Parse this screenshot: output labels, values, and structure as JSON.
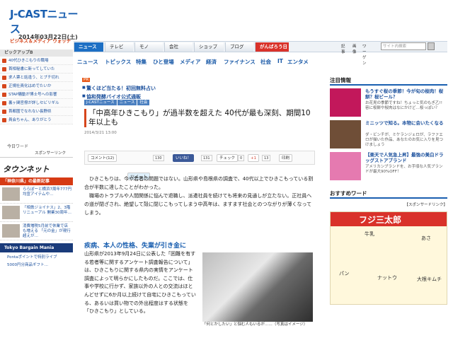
{
  "header": {
    "logo_main": "J-CASTニュース",
    "logo_sub": "ビジネス＆メディア ウォッチ",
    "date": "2014年03月22日(土)"
  },
  "nav": {
    "tabs": [
      {
        "label": "ニュース"
      },
      {
        "label": "テレビ"
      },
      {
        "label": "モノ"
      },
      {
        "label": "会社"
      },
      {
        "label": "ショップ"
      },
      {
        "label": "ブログ"
      },
      {
        "label": "がんばろう日本"
      }
    ],
    "search_tabs": [
      "記事",
      "画像",
      "ワーゲン"
    ],
    "search_placeholder": "サイト内検索"
  },
  "subnav": [
    "ニュース",
    "トピックス",
    "特集",
    "ひと登場",
    "メディア",
    "経済",
    "ファイナンス",
    "社会",
    "IT",
    "エンタメ"
  ],
  "left": {
    "pickup_title": "ピックアップB",
    "pickup_items": [
      "40代ひきこもりの職場",
      "首相秘書に新ってしていた",
      "求人票と話違う、とブチ切れ",
      "正規社員化はめでたいか",
      "STAP騒動が博士号への影響",
      "裏ヶ関官僚が詳しセビリギル",
      "首都圏でなれない長野県",
      "員会ちゃん、ありがとう"
    ],
    "tw_label": "今日ワード",
    "tw_sponsor": "スポンサーリンク",
    "townnet": "タウンネット",
    "kanagawa": "「神奈川県」の最新記事",
    "local_news": [
      "ららぽーと横浜7周年777円均宣アイテムや…",
      "「相鉄ジョイナス」2、3階リニューアル 開業30周年…",
      "消費増税5月前で休業で店も増える 「元の金」が現行超えが…"
    ],
    "tbm": "Tokyo Bargain Mania",
    "tbm_items": [
      "Pontaポイントで特別ライブ",
      "5000円分商品ギフト…"
    ]
  },
  "main": {
    "pr_badge": "PR",
    "pr_lines": [
      "驚くほど当たる！初回無料占い",
      "協和発酵バイオ公式通販"
    ],
    "crumbs": [
      "J-CASTニュース",
      "ニュース",
      "社会"
    ],
    "title": "「中高年ひきこもり」が過半数を超えた 40代が最も深刻、期間10年以上も",
    "pubdate": "2014/3/21 13:00",
    "share": {
      "comment": "コメント(12)",
      "tweet": "ツイート",
      "tweet_count": "130",
      "like": "いいね！",
      "like_count": "131",
      "check": "チェック",
      "check_count": "0",
      "gplus": "+1",
      "gplus_count": "13",
      "print": "印刷"
    },
    "body1": [
      "ひきこもりは、今や若者の問題ではない。山形県や島根県の調査で、40代以上でひきこもっている割合が半数に達したことがわかった。",
      "職場のトラブルや人間関係に悩んで退職し、派遣社員を続けても将来の見通しが立たない。正社員への道が閉ざされ、絶望して殻に閉じこもってしまう中高年は、ますます社会とのつながりが薄くなってしまう。"
    ],
    "section_heading": "疾病、本人の性格、失業が引き金に",
    "body2": "山形県が2013年9月24日に公表した「困難を有する若者等に関するアンケート調査報告について」は、ひきこもりに関する県内の実情をアンケート調査によって明らかにしたものだ。ここでは、仕事や学校に行かず、家族以外の人との交流はほとんどせずに6か月以上続けて自宅にひきこもっている、あるいは買い物での外出程度はする状態を「ひきこもり」としている。",
    "photo_caption": "「何とかしたい」と悩む人もいるが……（写真はイメージ）"
  },
  "right": {
    "heading1": "注目情報",
    "news": [
      {
        "title": "もうすぐ桜の季節！今が旬の桜肉！桜餅？桜ビール？",
        "desc": "お花見の季節ですね！ちょっと気のもぎ乙!!容に桜餅や桜肉はなにかけど…桜っぽい？"
      },
      {
        "title": "ミニッツで知る。本物に会いたくなる",
        "desc": "ダ・ビンチが、ミケランジェロが、ラファエロが描いた作品、あなたのお気に入りを見つけましょう"
      },
      {
        "title": "【楽天で人気急上昇】最強の美白ドラッグストアブランド",
        "desc": "アメリカンブランドを、お手頃な人気ブランドが最大90%OFF！"
      }
    ],
    "heading2": "おすすめワード",
    "sponsor": "【スポンサードリンク】",
    "ad_brand": "フジ三太郎",
    "ad_labels": [
      "牛乳",
      "あさ",
      "パン",
      "ナットウ",
      "大根キムチ"
    ]
  }
}
